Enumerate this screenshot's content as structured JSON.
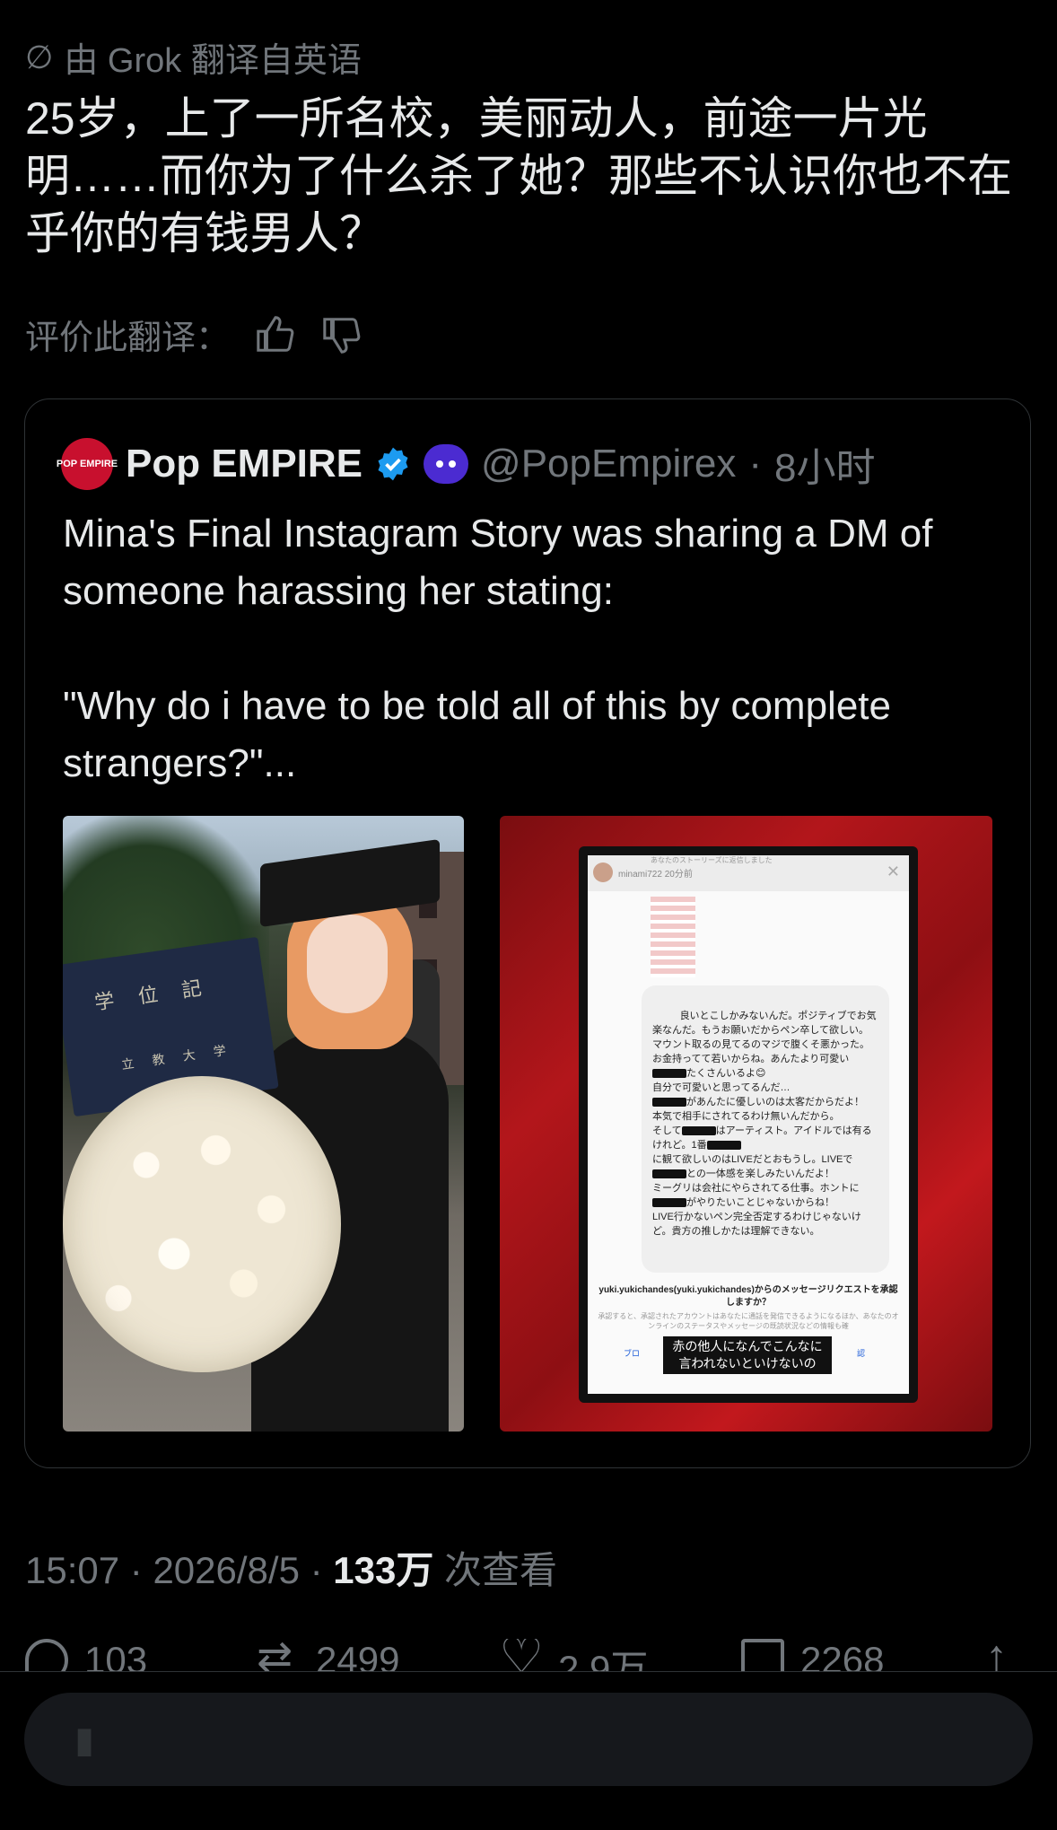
{
  "translation": {
    "label": "由 Grok 翻译自英语",
    "text": "25岁，上了一所名校，美丽动人，前途一片光明……而你为了什么杀了她？那些不认识你也不在乎你的有钱男人？",
    "rate_label": "评价此翻译："
  },
  "quote": {
    "avatar_text": "POP EMPIRE",
    "name": "Pop EMPIRE",
    "handle": "@PopEmpirex",
    "time": "8小时",
    "text": "Mina's Final Instagram Story was sharing a DM of someone harassing her stating:\n\n\"Why do i have to be told all of this by complete strangers?\"...",
    "image_left": {
      "diploma_title": "学 位 記",
      "diploma_school": "立 教 大 学"
    },
    "image_right": {
      "story_notice": "あなたのストーリーズに返信しました",
      "story_user": "minami722",
      "story_time": "20分前",
      "dm_lines": [
        "良いとこしかみないんだ。ポジティブでお気楽なんだ。もうお願いだからペン卒して欲しい。",
        "マウント取るの見てるのマジで腹くそ悪かった。",
        "お金持ってて若いからね。あんたより可愛い",
        "たくさんいるよ😊",
        "自分で可愛いと思ってるんだ…",
        "があんたに優しいのは太客だからだよ！",
        "本気で相手にされてるわけ無いんだから。",
        "そして",
        "はアーティスト。アイドルでは有るけれど。1番",
        "に観て欲しいのはLIVEだとおもうし。LIVEで",
        "との一体感を楽しみたいんだよ！",
        "ミーグリは会社にやらされてる仕事。ホントに",
        "がやりたいことじゃないからね！",
        "LIVE行かないペン完全否定するわけじゃないけど。貴方の推しかたは理解できない。"
      ],
      "request_title": "yuki.yukichandes(yuki.yukichandes)からのメッセージリクエストを承認しますか？",
      "request_sub": "承認すると、承認されたアカウントはあなたに通話を発信できるようになるほか、あなたのオンラインのステータスやメッセージの既読状況などの情報も確",
      "block": "ブロ",
      "accept": "認",
      "caption": "赤の他人になんでこんなに言われないといけないの"
    }
  },
  "meta": {
    "time": "15:07",
    "date": "2026/8/5",
    "views": "133万",
    "views_label": "次查看"
  },
  "actions": {
    "replies": "103",
    "retweets": "2499",
    "likes": "2.9万",
    "bookmarks": "2268"
  }
}
